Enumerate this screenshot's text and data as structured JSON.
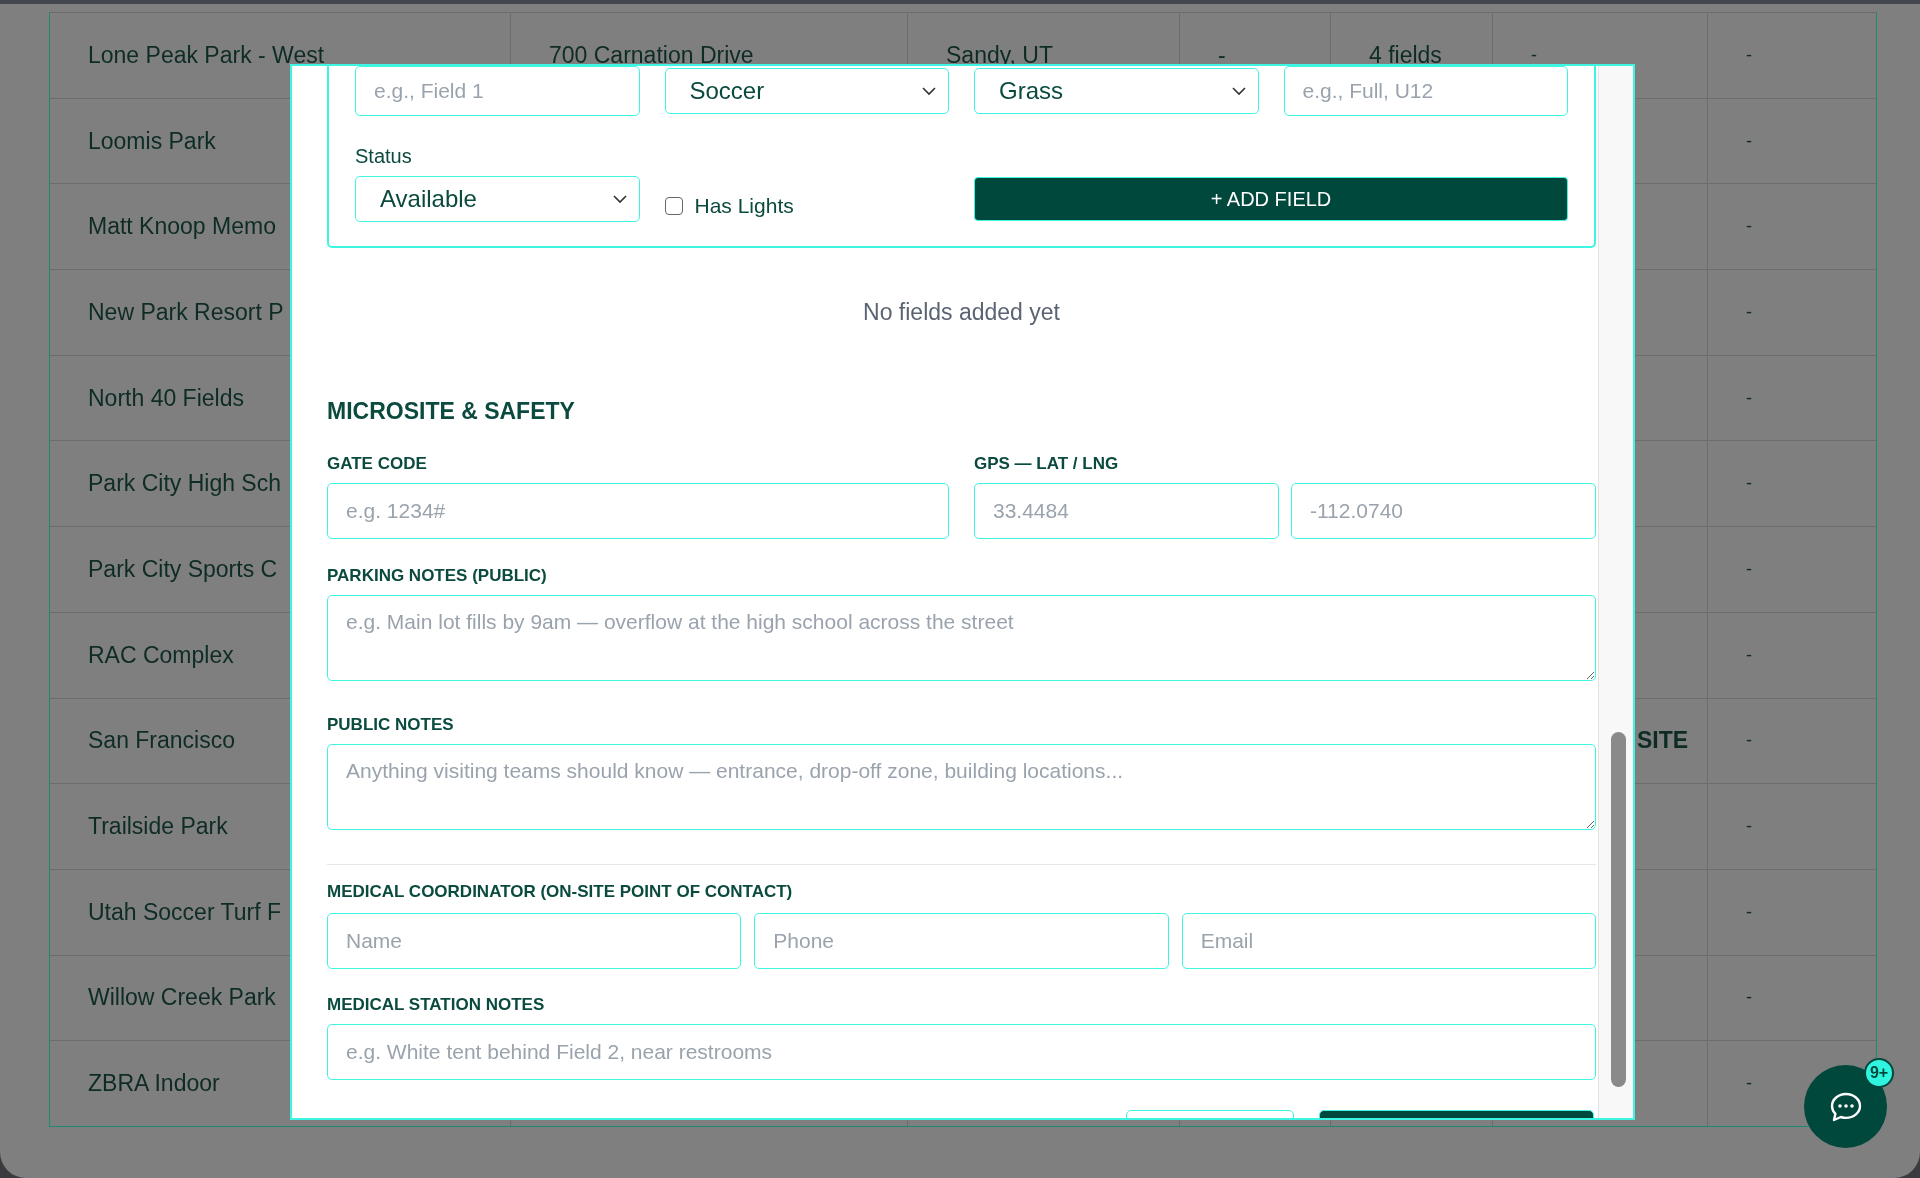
{
  "table": {
    "rows": [
      {
        "name": "Lone Peak Park - West",
        "column_2": "700 Carnation Drive",
        "column_3": "Sandy, UT",
        "column_4": "-",
        "column_5": "4 fields",
        "column_6": "-",
        "column_7": "-"
      },
      {
        "name": "Loomis Park",
        "column_7": "-"
      },
      {
        "name": "Matt Knoop Memo",
        "column_7": "-"
      },
      {
        "name": "New Park Resort P",
        "column_7": "-"
      },
      {
        "name": "North 40 Fields",
        "column_7": "-"
      },
      {
        "name": "Park City High Sch",
        "column_7": "-"
      },
      {
        "name": "Park City Sports C",
        "column_7": "-"
      },
      {
        "name": "RAC Complex",
        "column_7": "-"
      },
      {
        "name": "San Francisco",
        "column_6": "SITE",
        "column_7": "-"
      },
      {
        "name": "Trailside Park",
        "column_7": "-"
      },
      {
        "name": "Utah Soccer Turf F",
        "column_7": "-"
      },
      {
        "name": "Willow Creek Park",
        "column_7": "-"
      },
      {
        "name": "ZBRA Indoor",
        "column_7": "-"
      }
    ]
  },
  "modal": {
    "field_form": {
      "inputs": [
        {
          "kind": "text",
          "placeholder": "e.g., Field 1"
        },
        {
          "kind": "select",
          "value": "Soccer"
        },
        {
          "kind": "select",
          "value": "Grass"
        },
        {
          "kind": "text",
          "placeholder": "e.g., Full, U12"
        }
      ],
      "status_label": "Status",
      "status_value": "Available",
      "has_lights": {
        "label": "Has Lights",
        "checked": false
      },
      "add_button": "+ ADD FIELD"
    },
    "empty_message": "No fields added yet",
    "section_title": "MICROSITE & SAFETY",
    "gate_code": {
      "label": "GATE CODE",
      "placeholder": "e.g. 1234#"
    },
    "gps": {
      "label": "GPS — LAT / LNG",
      "lat_placeholder": "33.4484",
      "lng_placeholder": "-112.0740"
    },
    "parking_notes": {
      "label": "PARKING NOTES (PUBLIC)",
      "placeholder": "e.g. Main lot fills by 9am — overflow at the high school across the street"
    },
    "public_notes": {
      "label": "PUBLIC NOTES",
      "placeholder": "Anything visiting teams should know — entrance, drop-off zone, building locations..."
    },
    "medical_coordinator": {
      "label": "MEDICAL COORDINATOR (ON-SITE POINT OF CONTACT)",
      "placeholders": [
        "Name",
        "Phone",
        "Email"
      ]
    },
    "medical_station_notes": {
      "label": "MEDICAL STATION NOTES",
      "placeholder": "e.g. White tent behind Field 2, near restrooms"
    },
    "footer_buttons": [
      {
        "kind": "outline"
      },
      {
        "kind": "primary"
      }
    ]
  },
  "chat_button": {
    "badge": "9+"
  }
}
